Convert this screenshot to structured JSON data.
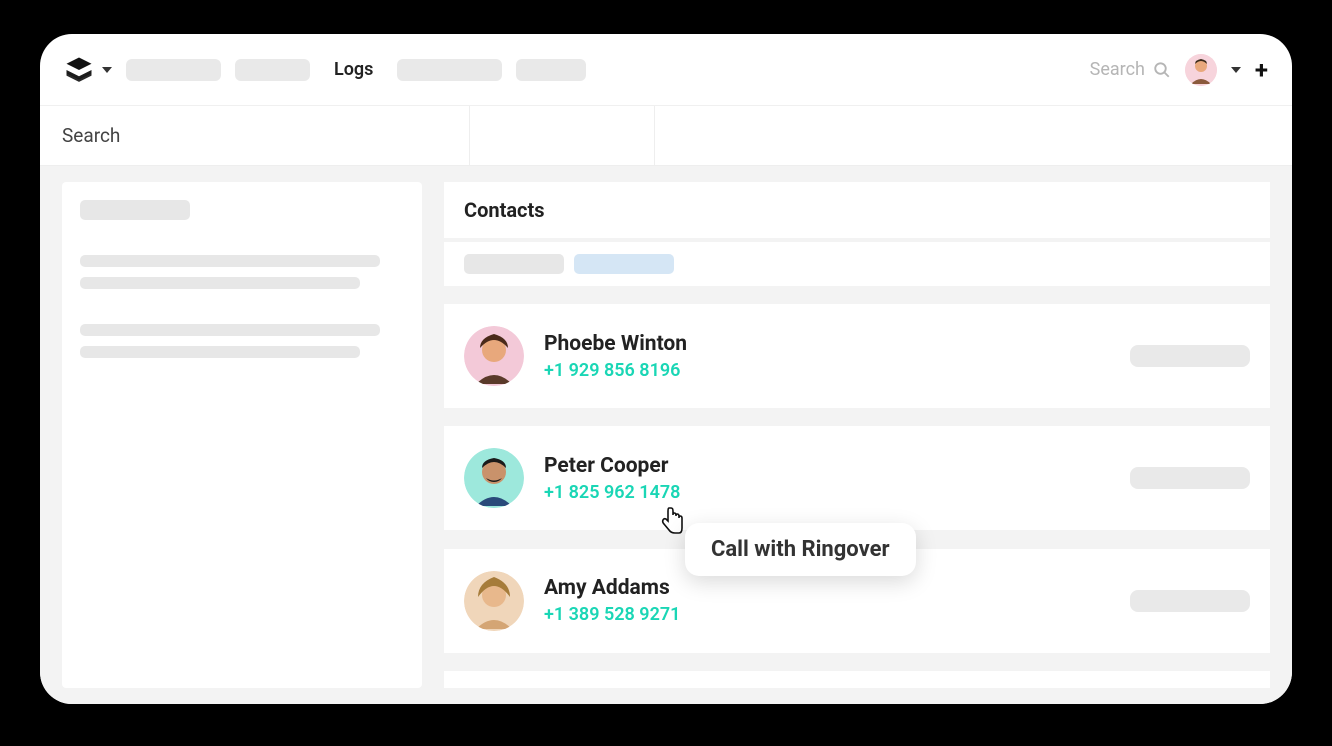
{
  "topbar": {
    "active_tab_label": "Logs",
    "search_placeholder": "Search",
    "plus_label": "+"
  },
  "subtabs": {
    "search_label": "Search"
  },
  "section": {
    "title": "Contacts"
  },
  "contacts": [
    {
      "name": "Phoebe Winton",
      "phone": "+1 929 856 8196",
      "avatar_bg": "#f3c9d8"
    },
    {
      "name": "Peter Cooper",
      "phone": "+1 825 962 1478",
      "avatar_bg": "#9de8dc"
    },
    {
      "name": "Amy Addams",
      "phone": "+1 389 528 9271",
      "avatar_bg": "#f0d6ba"
    }
  ],
  "tooltip": {
    "label": "Call with Ringover"
  },
  "colors": {
    "phone_link": "#1ad6b5",
    "placeholder_gray": "#e7e7e7",
    "body_bg": "#f3f3f3"
  }
}
